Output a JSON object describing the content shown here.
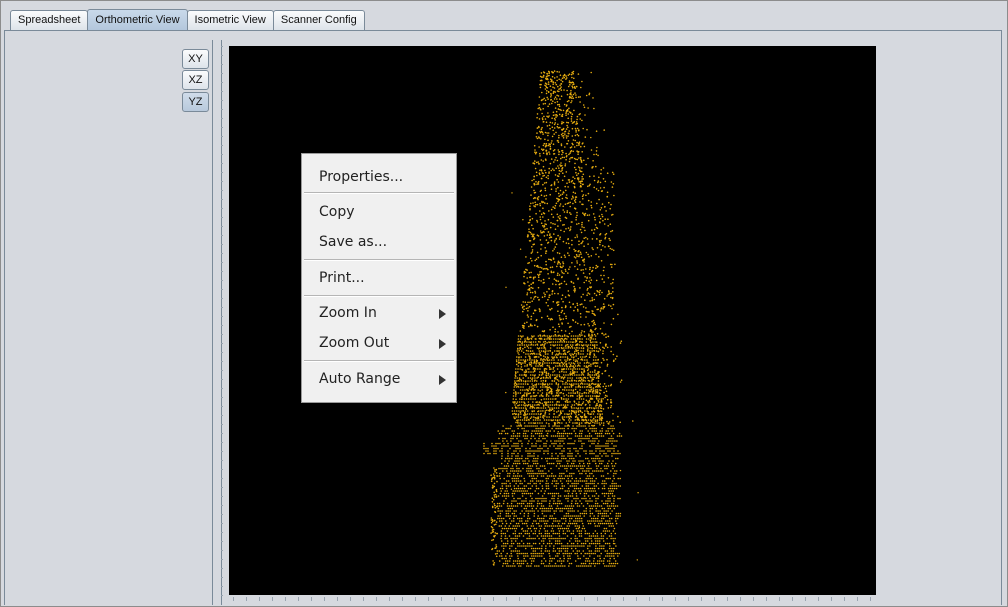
{
  "tabs": [
    {
      "label": "Spreadsheet",
      "active": false
    },
    {
      "label": "Orthometric View",
      "active": true
    },
    {
      "label": "Isometric View",
      "active": false
    },
    {
      "label": "Scanner Config",
      "active": false
    }
  ],
  "view_buttons": [
    {
      "label": "XY",
      "selected": false
    },
    {
      "label": "XZ",
      "selected": false
    },
    {
      "label": "YZ",
      "selected": true
    }
  ],
  "plot": {
    "background_color": "#000000",
    "point_color": "#e6ac10"
  },
  "context_menu": {
    "properties": "Properties...",
    "copy": "Copy",
    "save_as": "Save as...",
    "print": "Print...",
    "zoom_in": "Zoom In",
    "zoom_out": "Zoom Out",
    "auto_range": "Auto Range"
  }
}
